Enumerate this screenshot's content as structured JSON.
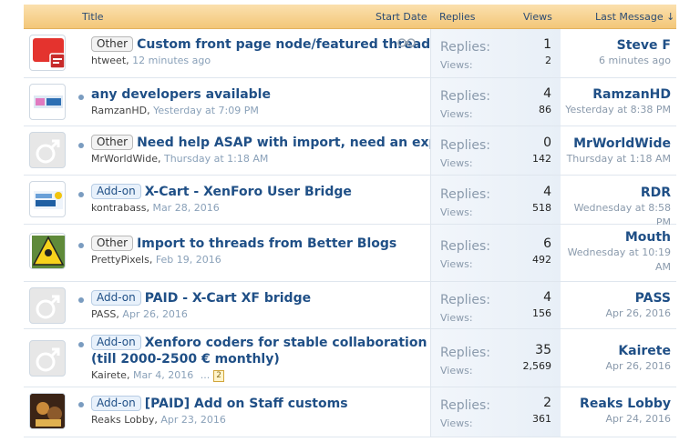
{
  "header": {
    "title": "Title",
    "start_date": "Start Date",
    "replies": "Replies",
    "views": "Views",
    "last_message": "Last Message ↓"
  },
  "labels": {
    "replies": "Replies:",
    "views": "Views:"
  },
  "threads": [
    {
      "prefix": "Other",
      "title": "Custom front page node/featured threads",
      "author": "htweet",
      "date": "12 minutes ago",
      "replies": "1",
      "views": "2",
      "last_user": "Steve F",
      "last_time": "6 minutes ago"
    },
    {
      "prefix": "",
      "title": "any developers available",
      "author": "RamzanHD",
      "date": "Yesterday at 7:09 PM",
      "replies": "4",
      "views": "86",
      "last_user": "RamzanHD",
      "last_time": "Yesterday at 8:38 PM"
    },
    {
      "prefix": "Other",
      "title": "Need help ASAP with import, need an expert",
      "author": "MrWorldWide",
      "date": "Thursday at 1:18 AM",
      "replies": "0",
      "views": "142",
      "last_user": "MrWorldWide",
      "last_time": "Thursday at 1:18 AM"
    },
    {
      "prefix": "Add-on",
      "title": "X-Cart - XenForo User Bridge",
      "author": "kontrabass",
      "date": "Mar 28, 2016",
      "replies": "4",
      "views": "518",
      "last_user": "RDR",
      "last_time": "Wednesday at 8:58 PM"
    },
    {
      "prefix": "Other",
      "title": "Import to threads from Better Blogs",
      "author": "PrettyPixels",
      "date": "Feb 19, 2016",
      "replies": "6",
      "views": "492",
      "last_user": "Mouth",
      "last_time": "Wednesday at 10:19 AM"
    },
    {
      "prefix": "Add-on",
      "title": "PAID - X-Cart XF bridge",
      "author": "PASS",
      "date": "Apr 26, 2016",
      "replies": "4",
      "views": "156",
      "last_user": "PASS",
      "last_time": "Apr 26, 2016"
    },
    {
      "prefix": "Add-on",
      "title": "Xenforo coders for stable collaboration (till 2000-2500 € monthly)",
      "author": "Kairete",
      "date": "Mar 4, 2016",
      "page_ellipsis": "...",
      "page_link": "2",
      "replies": "35",
      "views": "2,569",
      "last_user": "Kairete",
      "last_time": "Apr 26, 2016"
    },
    {
      "prefix": "Add-on",
      "title": "[PAID] Add on Staff customs",
      "author": "Reaks Lobby",
      "date": "Apr 23, 2016",
      "replies": "2",
      "views": "361",
      "last_user": "Reaks Lobby",
      "last_time": "Apr 24, 2016"
    }
  ]
}
